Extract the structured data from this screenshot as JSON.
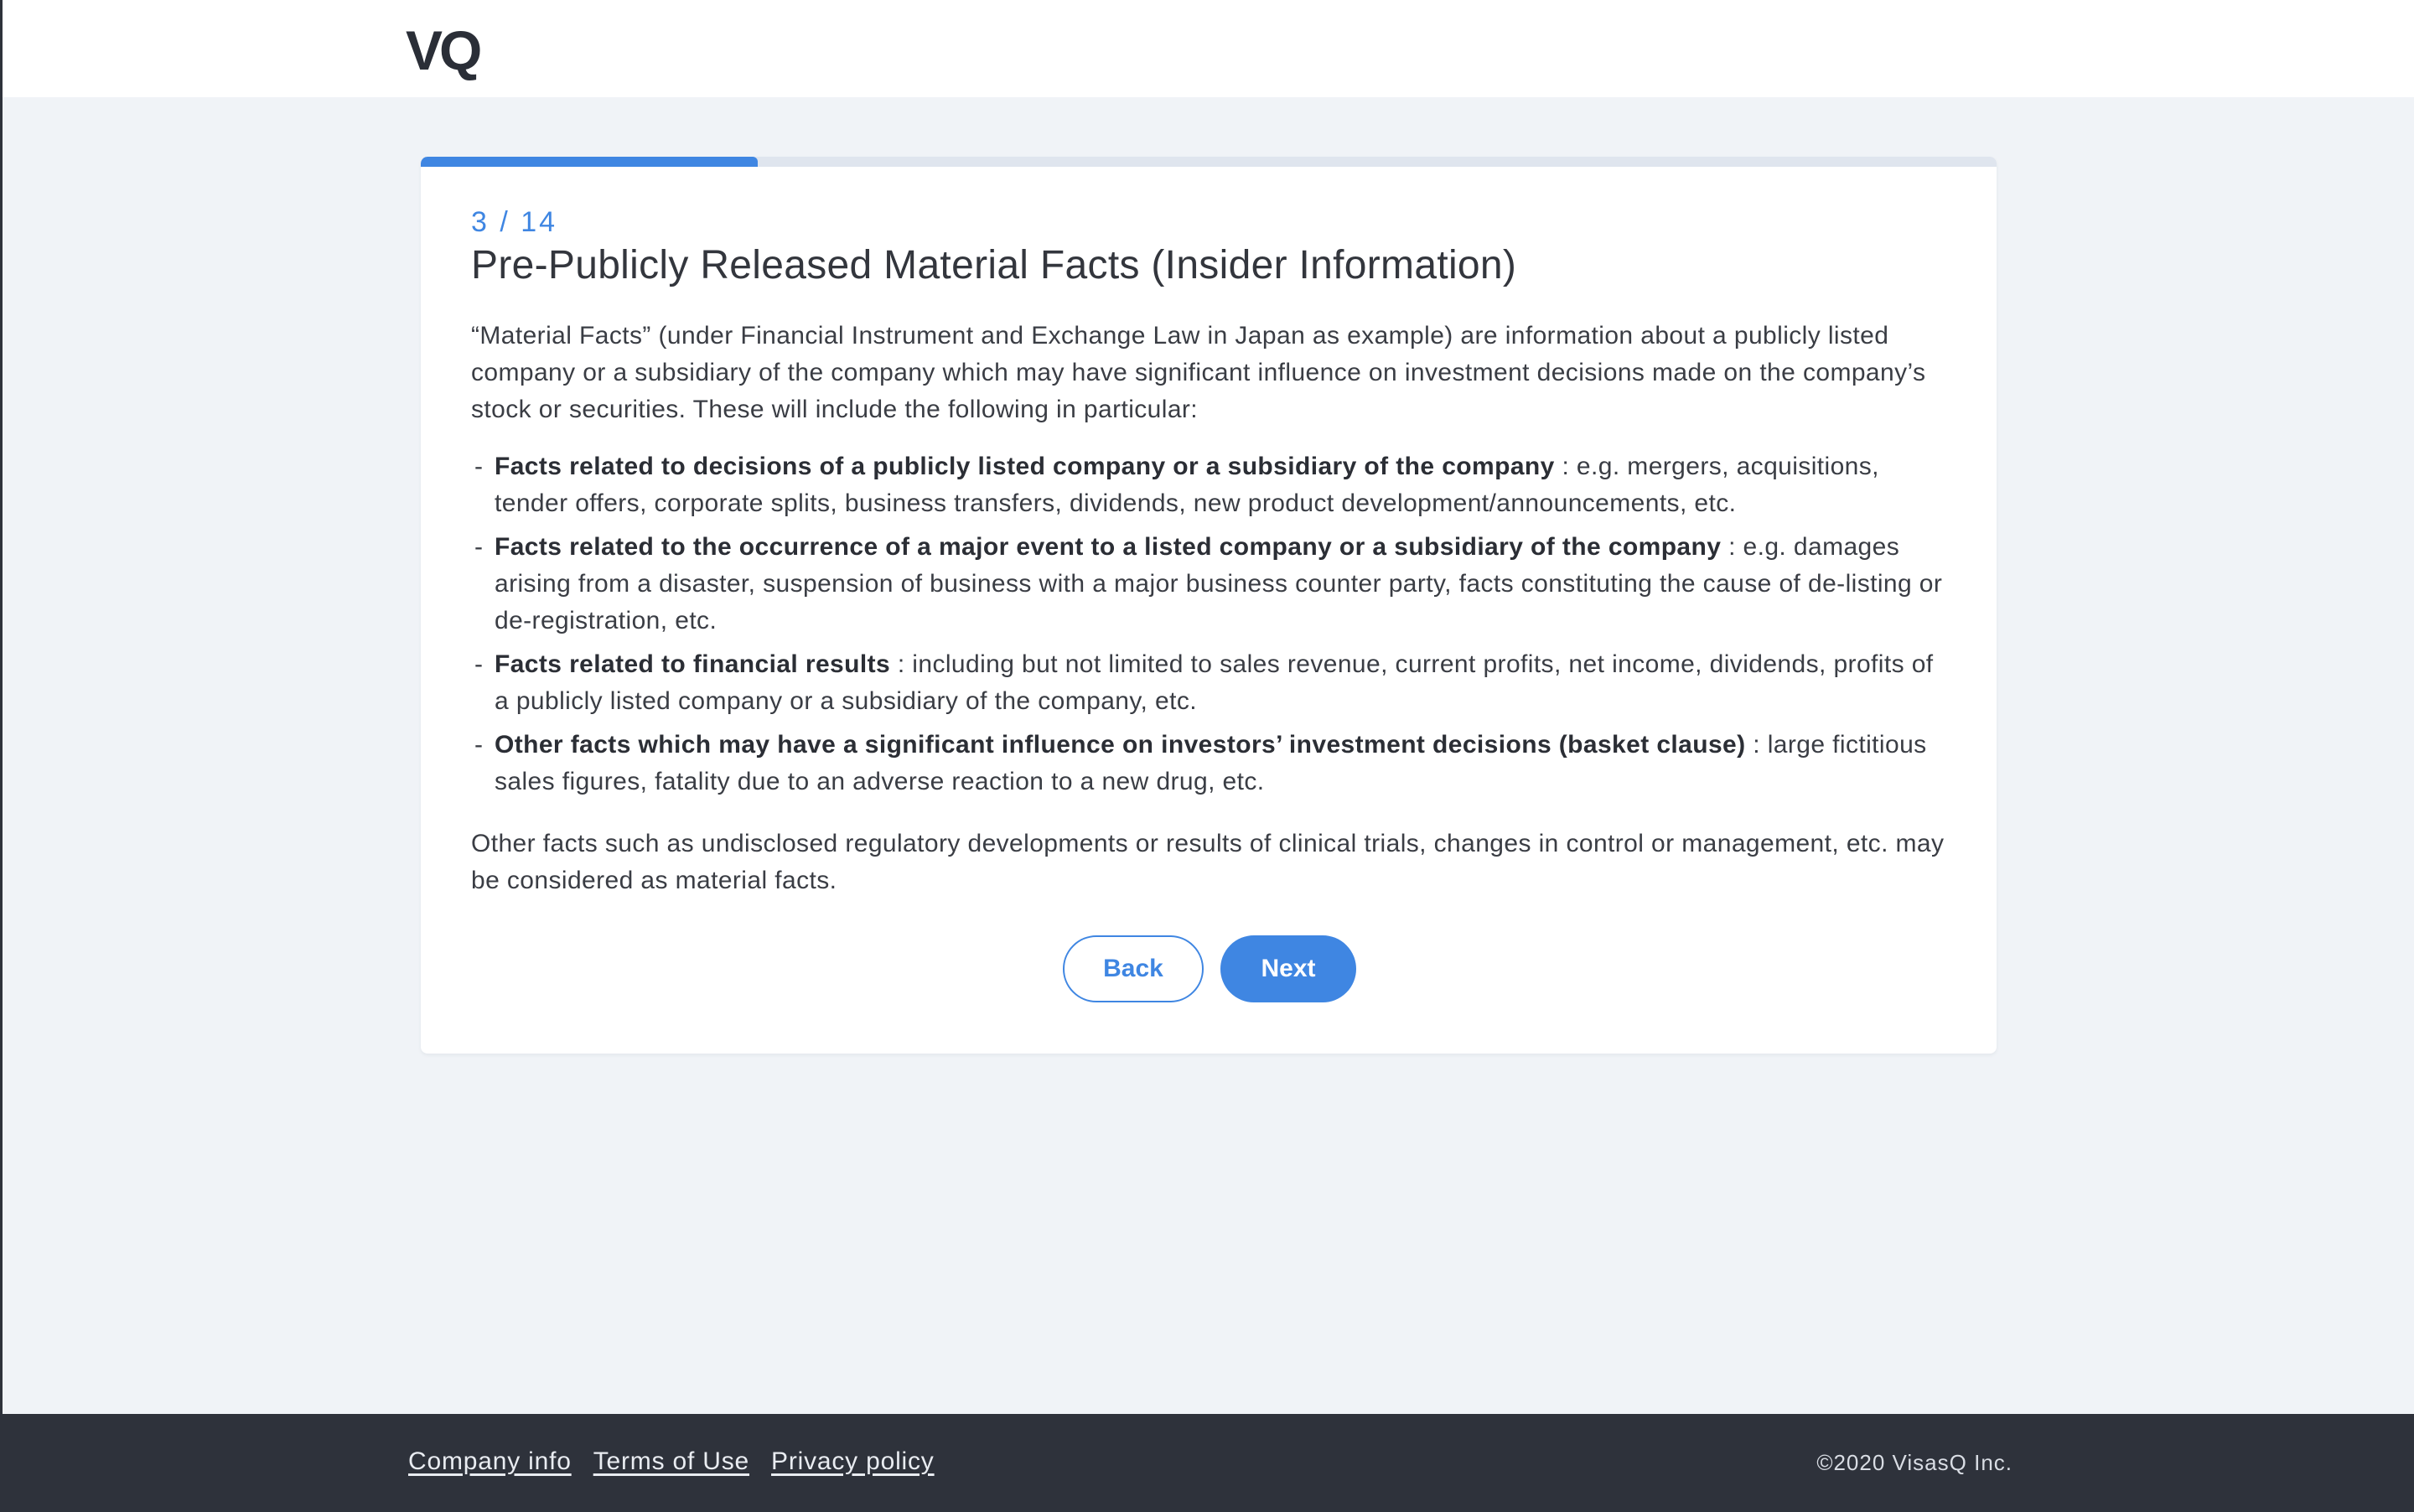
{
  "header": {
    "logo_text": "VQ"
  },
  "progress": {
    "current": 3,
    "total": 14,
    "fraction": 0.214,
    "step_label": "3 / 14"
  },
  "content": {
    "title": "Pre-Publicly Released Material Facts (Insider Information)",
    "intro": "“Material Facts” (under Financial Instrument and Exchange Law in Japan as example) are information about a publicly listed company or a subsidiary of the company which may have significant influence on investment decisions made on the company’s stock or securities. These will include the following in particular:",
    "facts": [
      {
        "dash": "-",
        "lead": "Facts related to decisions of a publicly listed company or a subsidiary of the company",
        "detail": " : e.g. mergers, acquisitions, tender offers, corporate splits, business transfers, dividends, new product development/announcements, etc."
      },
      {
        "dash": "-",
        "lead": "Facts related to the occurrence of a major event to a listed company or a subsidiary of the company",
        "detail": " : e.g. damages arising from a disaster, suspension of business with a major business counter party, facts constituting the cause of de-listing or de-registration, etc."
      },
      {
        "dash": "-",
        "lead": "Facts related to financial results",
        "detail": " : including but not limited to sales revenue, current profits, net income, dividends, profits of a publicly listed company or a subsidiary of the company, etc."
      },
      {
        "dash": "-",
        "lead": "Other facts which may have a significant influence on investors’ investment decisions (basket clause)",
        "detail": " : large fictitious sales figures, fatality due to an adverse reaction to a new drug, etc."
      }
    ],
    "closing": "Other facts such as undisclosed regulatory developments or results of clinical trials, changes in control or management, etc. may be considered as material facts."
  },
  "buttons": {
    "back_label": "Back",
    "next_label": "Next"
  },
  "footer": {
    "links": [
      {
        "label": "Company info"
      },
      {
        "label": "Terms of Use"
      },
      {
        "label": "Privacy policy"
      }
    ],
    "copyright": "©2020 VisasQ Inc."
  },
  "colors": {
    "accent": "#3f86e2",
    "page_background": "#f0f3f7",
    "footer_background": "#2e323b"
  }
}
